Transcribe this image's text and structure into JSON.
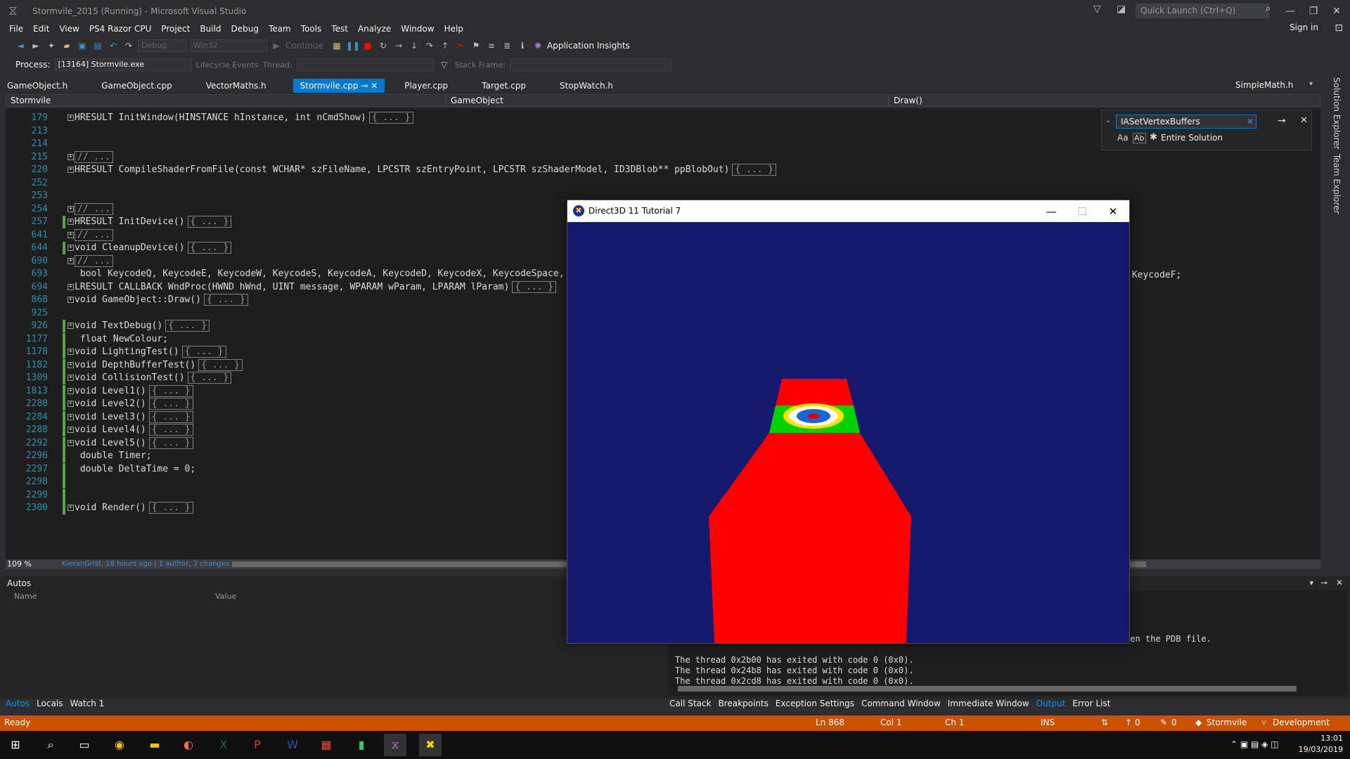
{
  "title": {
    "text": "Stormvile_2015 (Running) - Microsoft Visual Studio",
    "quick_launch_placeholder": "Quick Launch (Ctrl+Q)",
    "sign_in": "Sign in"
  },
  "menu": [
    "File",
    "Edit",
    "View",
    "PS4 Razor CPU",
    "Project",
    "Build",
    "Debug",
    "Team",
    "Tools",
    "Test",
    "Analyze",
    "Window",
    "Help"
  ],
  "toolbar": {
    "config": "Debug",
    "platform": "Win32",
    "continue": "Continue",
    "app_insights": "Application Insights",
    "process_label": "Process:",
    "process_value": "[13164] Stormvile.exe",
    "lifecycle": "Lifecycle Events",
    "thread_label": "Thread:",
    "stack_label": "Stack Frame:"
  },
  "tabs": [
    "GameObject.h",
    "GameObject.cpp",
    "VectorMaths.h",
    "Stormvile.cpp",
    "Player.cpp",
    "Target.cpp",
    "StopWatch.h"
  ],
  "active_tab": "Stormvile.cpp",
  "right_tab": "SimpleMath.h",
  "nav": {
    "project": "Stormvile",
    "scope": "GameObject",
    "member": "Draw()"
  },
  "find": {
    "query": "IASetVertexBuffers",
    "scope": "Entire Solution",
    "opt_case": "Aa",
    "opt_word": "Ab"
  },
  "code_lines": [
    {
      "n": "179",
      "text": "HRESULT InitWindow(HINSTANCE hInstance, int nCmdShow)",
      "box": "{ ... }",
      "fold": true
    },
    {
      "n": "213",
      "text": ""
    },
    {
      "n": "214",
      "text": ""
    },
    {
      "n": "215",
      "text": "",
      "box": "// ...",
      "fold": true
    },
    {
      "n": "220",
      "text": "HRESULT CompileShaderFromFile(const WCHAR* szFileName, LPCSTR szEntryPoint, LPCSTR szShaderModel, ID3DBlob** ppBlobOut)",
      "box": "{ ... }",
      "fold": true
    },
    {
      "n": "252",
      "text": ""
    },
    {
      "n": "253",
      "text": ""
    },
    {
      "n": "254",
      "text": "",
      "box": "// ...",
      "fold": true
    },
    {
      "n": "257",
      "text": "HRESULT InitDevice()",
      "box": "{ ... }",
      "fold": true,
      "mark": true
    },
    {
      "n": "641",
      "text": "",
      "box": "// ...",
      "fold": true
    },
    {
      "n": "644",
      "text": "void CleanupDevice()",
      "box": "{ ... }",
      "fold": true,
      "mark": true
    },
    {
      "n": "690",
      "text": "",
      "box": "// ...",
      "fold": true
    },
    {
      "n": "693",
      "text": " bool KeycodeQ, KeycodeE, KeycodeW, KeycodeS, KeycodeA, KeycodeD, KeycodeX, KeycodeSpace, K"
    },
    {
      "n": "694",
      "text": "LRESULT CALLBACK WndProc(HWND hWnd, UINT message, WPARAM wParam, LPARAM lParam)",
      "box": "{ ... }",
      "fold": true
    },
    {
      "n": "868",
      "text": "void GameObject::Draw()",
      "box": "{ ... }",
      "fold": true
    },
    {
      "n": "925",
      "text": ""
    },
    {
      "n": "926",
      "text": "void TextDebug()",
      "box": "{ ... }",
      "fold": true,
      "mark": true
    },
    {
      "n": "1177",
      "text": " float NewColour;",
      "mark": true
    },
    {
      "n": "1178",
      "text": "void LightingTest()",
      "box": "{ ... }",
      "fold": true,
      "mark": true
    },
    {
      "n": "1182",
      "text": "void DepthBufferTest()",
      "box": "{ ... }",
      "fold": true,
      "mark": true
    },
    {
      "n": "1309",
      "text": "void CollisionTest()",
      "box": "{ ... }",
      "fold": true,
      "mark": true
    },
    {
      "n": "1813",
      "text": "void Level1()",
      "box": "{ ... }",
      "fold": true,
      "mark": true
    },
    {
      "n": "2280",
      "text": "void Level2()",
      "box": "{ ... }",
      "fold": true,
      "mark": true
    },
    {
      "n": "2284",
      "text": "void Level3()",
      "box": "{ ... }",
      "fold": true,
      "mark": true
    },
    {
      "n": "2288",
      "text": "void Level4()",
      "box": "{ ... }",
      "fold": true,
      "mark": true
    },
    {
      "n": "2292",
      "text": "void Level5()",
      "box": "{ ... }",
      "fold": true,
      "mark": true
    },
    {
      "n": "2296",
      "text": " double Timer;",
      "mark": true
    },
    {
      "n": "2297",
      "text": " double DeltaTime = 0;",
      "mark": true
    },
    {
      "n": "2298",
      "text": "",
      "mark": true
    },
    {
      "n": "2299",
      "text": "",
      "mark": true
    },
    {
      "n": "2300",
      "text": "void Render()",
      "box": "{ ... }",
      "fold": true,
      "mark": true
    }
  ],
  "trailing_code": ",KeycodeF;",
  "editor_footer": {
    "zoom": "109 %",
    "blame_author": "KieranGrist, 18 hours ago",
    "blame_changes": "1 author, 3 changes"
  },
  "autos": {
    "title": "Autos",
    "col_name": "Name",
    "col_value": "Value"
  },
  "output": {
    "lines": [
      "pen the PDB file.",
      "The thread 0x2b00 has exited with code 0 (0x0).",
      "The thread 0x24b8 has exited with code 0 (0x0).",
      "The thread 0x2cd8 has exited with code 0 (0x0)."
    ]
  },
  "bottom_tabs_left": [
    "Autos",
    "Locals",
    "Watch 1"
  ],
  "bottom_tabs_right": [
    "Call Stack",
    "Breakpoints",
    "Exception Settings",
    "Command Window",
    "Immediate Window",
    "Output",
    "Error List"
  ],
  "side_tabs": [
    "Solution Explorer",
    "Team Explorer"
  ],
  "status": {
    "ready": "Ready",
    "ln": "Ln 868",
    "col": "Col 1",
    "ch": "Ch 1",
    "ins": "INS",
    "up_count": "0",
    "edit_count": "0",
    "repo": "Stormvile",
    "branch": "Development"
  },
  "d3d": {
    "title": "Direct3D 11 Tutorial 7"
  },
  "taskbar": {
    "time": "13:01",
    "date": "19/03/2019"
  },
  "colors": {
    "accent": "#007acc",
    "status": "#ca5100",
    "d3d_bg": "#141a6e"
  }
}
